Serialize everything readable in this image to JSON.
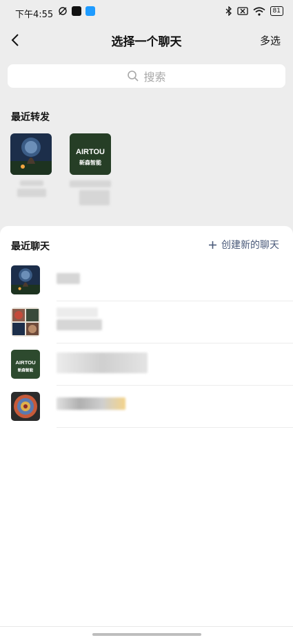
{
  "status_bar": {
    "time": "下午4:55",
    "battery": "81"
  },
  "header": {
    "title": "选择一个聊天",
    "multi_select": "多选"
  },
  "search": {
    "placeholder": "搜索"
  },
  "recent_forwards": {
    "title": "最近转发",
    "items": [
      {
        "avatar": "night-campfire-avatar"
      },
      {
        "avatar": "airtou-logo-avatar",
        "logo_text": "AIRTOU",
        "logo_sub": "新森智能"
      }
    ]
  },
  "recent_chats": {
    "title": "最近聊天",
    "create_new": "创建新的聊天",
    "items": [
      {
        "avatar": "night-campfire-avatar"
      },
      {
        "avatar": "collage-avatar"
      },
      {
        "avatar": "airtou-logo-avatar",
        "logo_text": "AIRTOU",
        "logo_sub": "新森智能"
      },
      {
        "avatar": "mandala-avatar"
      }
    ]
  },
  "colors": {
    "background": "#ededed",
    "sheet": "#ffffff",
    "link": "#4a5a7a",
    "placeholder": "#a8a8a8"
  }
}
